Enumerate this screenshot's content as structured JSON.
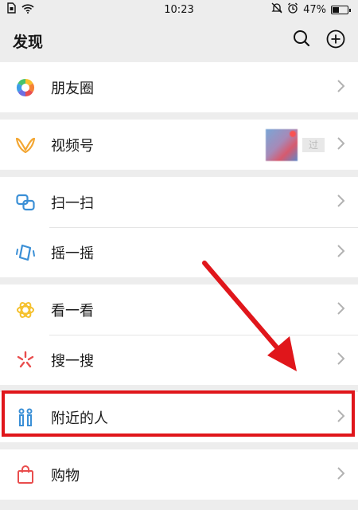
{
  "status_bar": {
    "time": "10:23",
    "battery": "47%"
  },
  "nav": {
    "title": "发现"
  },
  "sections": [
    {
      "items": [
        {
          "label": "朋友圈"
        }
      ]
    },
    {
      "items": [
        {
          "label": "视频号",
          "thumb_text": "过"
        }
      ]
    },
    {
      "items": [
        {
          "label": "扫一扫"
        },
        {
          "label": "摇一摇"
        }
      ]
    },
    {
      "items": [
        {
          "label": "看一看"
        },
        {
          "label": "搜一搜"
        }
      ]
    },
    {
      "items": [
        {
          "label": "附近的人"
        }
      ]
    },
    {
      "items": [
        {
          "label": "购物"
        }
      ]
    }
  ],
  "colors": {
    "highlight": "#e0161b",
    "background": "#ededed"
  },
  "icons": [
    "moments-icon",
    "channels-icon",
    "scan-icon",
    "shake-icon",
    "top-stories-icon",
    "search-feature-icon",
    "people-nearby-icon",
    "shopping-bag-icon"
  ]
}
